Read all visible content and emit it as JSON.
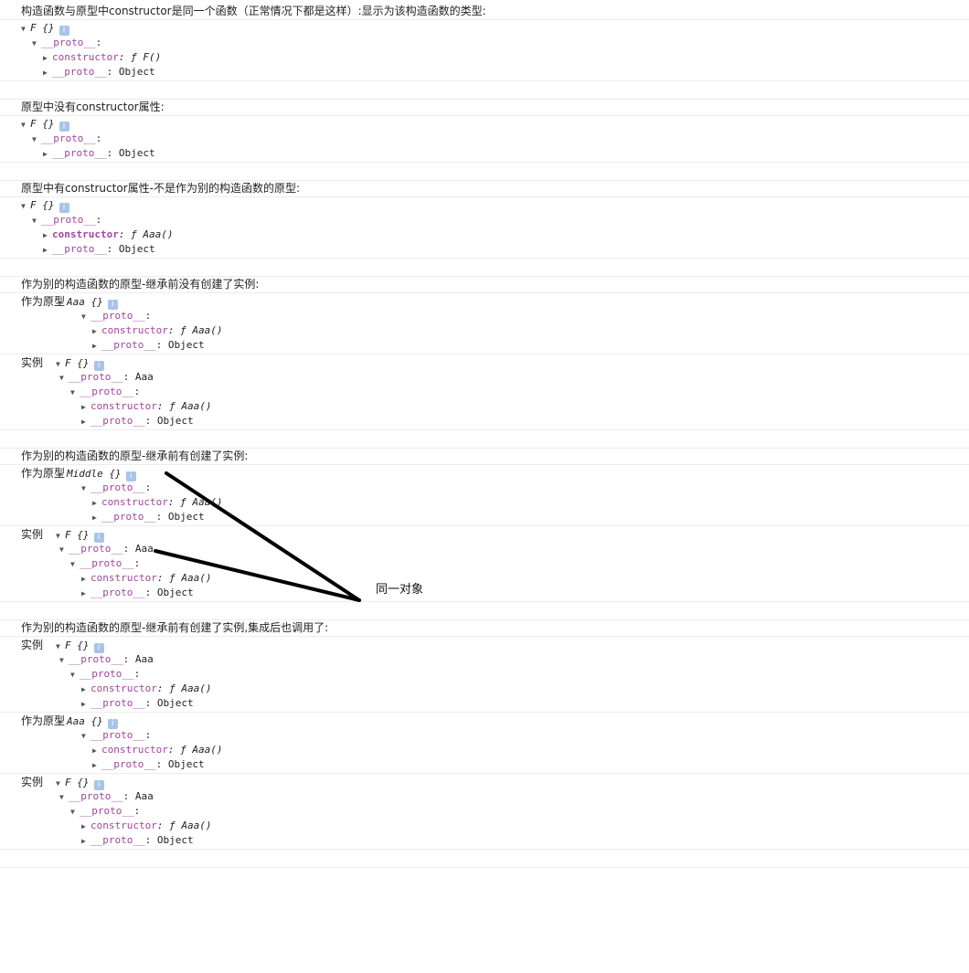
{
  "groups": [
    {
      "title": "构造函数与原型中constructor是同一个函数（正常情况下都是这样）:显示为该构造函数的类型:",
      "entries": [
        {
          "label": "",
          "lines": [
            {
              "d": 0,
              "t": "▼",
              "k": "F {}",
              "s": "obj",
              "info": true
            },
            {
              "d": 1,
              "t": "▼",
              "k": "__proto__",
              "v": ":"
            },
            {
              "d": 2,
              "t": "▶",
              "k": "constructor",
              "v": ": ƒ F()",
              "fn": true
            },
            {
              "d": 2,
              "t": "▶",
              "k": "__proto__",
              "v": ": Object"
            }
          ]
        }
      ]
    },
    {
      "title": "原型中没有constructor属性:",
      "entries": [
        {
          "label": "",
          "lines": [
            {
              "d": 0,
              "t": "▼",
              "k": "F {}",
              "s": "obj",
              "info": true
            },
            {
              "d": 1,
              "t": "▼",
              "k": "__proto__",
              "v": ":"
            },
            {
              "d": 2,
              "t": "▶",
              "k": "__proto__",
              "v": ": Object"
            }
          ]
        }
      ]
    },
    {
      "title": "原型中有constructor属性-不是作为别的构造函数的原型:",
      "entries": [
        {
          "label": "",
          "lines": [
            {
              "d": 0,
              "t": "▼",
              "k": "F {}",
              "s": "obj",
              "info": true
            },
            {
              "d": 1,
              "t": "▼",
              "k": "__proto__",
              "v": ":"
            },
            {
              "d": 2,
              "t": "▶",
              "k": "constructor",
              "v": ": ƒ Aaa()",
              "fn": true,
              "hl": true
            },
            {
              "d": 2,
              "t": "▶",
              "k": "__proto__",
              "v": ": Object"
            }
          ]
        }
      ]
    },
    {
      "title": "作为别的构造函数的原型-继承前没有创建了实例:",
      "entries": [
        {
          "label": "作为原型",
          "lines": [
            {
              "d": 0,
              "t": "▼",
              "k": "Aaa {}",
              "s": "obj",
              "info": true
            },
            {
              "d": 1,
              "t": "▼",
              "k": "__proto__",
              "v": ":"
            },
            {
              "d": 2,
              "t": "▶",
              "k": "constructor",
              "v": ": ƒ Aaa()",
              "fn": true
            },
            {
              "d": 2,
              "t": "▶",
              "k": "__proto__",
              "v": ": Object"
            }
          ]
        },
        {
          "label": "实例",
          "lines": [
            {
              "d": 0,
              "t": "▼",
              "k": "F {}",
              "s": "obj",
              "info": true
            },
            {
              "d": 1,
              "t": "▼",
              "k": "__proto__",
              "v": ": Aaa"
            },
            {
              "d": 2,
              "t": "▼",
              "k": "__proto__",
              "v": ":"
            },
            {
              "d": 3,
              "t": "▶",
              "k": "constructor",
              "v": ": ƒ Aaa()",
              "fn": true
            },
            {
              "d": 3,
              "t": "▶",
              "k": "__proto__",
              "v": ": Object"
            }
          ]
        }
      ]
    },
    {
      "title": "作为别的构造函数的原型-继承前有创建了实例:",
      "entries": [
        {
          "label": "作为原型",
          "lines": [
            {
              "d": 0,
              "t": "▼",
              "k": "Middle {}",
              "s": "obj",
              "info": true
            },
            {
              "d": 1,
              "t": "▼",
              "k": "__proto__",
              "v": ":"
            },
            {
              "d": 2,
              "t": "▶",
              "k": "constructor",
              "v": ": ƒ Aaa()",
              "fn": true
            },
            {
              "d": 2,
              "t": "▶",
              "k": "__proto__",
              "v": ": Object"
            }
          ]
        },
        {
          "label": "实例",
          "lines": [
            {
              "d": 0,
              "t": "▼",
              "k": "F {}",
              "s": "obj",
              "info": true
            },
            {
              "d": 1,
              "t": "▼",
              "k": "__proto__",
              "v": ": Aaa"
            },
            {
              "d": 2,
              "t": "▼",
              "k": "__proto__",
              "v": ":"
            },
            {
              "d": 3,
              "t": "▶",
              "k": "constructor",
              "v": ": ƒ Aaa()",
              "fn": true
            },
            {
              "d": 3,
              "t": "▶",
              "k": "__proto__",
              "v": ": Object"
            }
          ]
        }
      ]
    },
    {
      "title": "作为别的构造函数的原型-继承前有创建了实例,集成后也调用了:",
      "entries": [
        {
          "label": "实例",
          "lines": [
            {
              "d": 0,
              "t": "▼",
              "k": "F {}",
              "s": "obj",
              "info": true
            },
            {
              "d": 1,
              "t": "▼",
              "k": "__proto__",
              "v": ": Aaa"
            },
            {
              "d": 2,
              "t": "▼",
              "k": "__proto__",
              "v": ":"
            },
            {
              "d": 3,
              "t": "▶",
              "k": "constructor",
              "v": ": ƒ Aaa()",
              "fn": true
            },
            {
              "d": 3,
              "t": "▶",
              "k": "__proto__",
              "v": ": Object"
            }
          ]
        },
        {
          "label": "作为原型",
          "lines": [
            {
              "d": 0,
              "t": "▼",
              "k": "Aaa {}",
              "s": "obj",
              "info": true
            },
            {
              "d": 1,
              "t": "▼",
              "k": "__proto__",
              "v": ":"
            },
            {
              "d": 2,
              "t": "▶",
              "k": "constructor",
              "v": ": ƒ Aaa()",
              "fn": true
            },
            {
              "d": 2,
              "t": "▶",
              "k": "__proto__",
              "v": ": Object"
            }
          ]
        },
        {
          "label": "实例",
          "lines": [
            {
              "d": 0,
              "t": "▼",
              "k": "F {}",
              "s": "obj",
              "info": true
            },
            {
              "d": 1,
              "t": "▼",
              "k": "__proto__",
              "v": ": Aaa"
            },
            {
              "d": 2,
              "t": "▼",
              "k": "__proto__",
              "v": ":"
            },
            {
              "d": 3,
              "t": "▶",
              "k": "constructor",
              "v": ": ƒ Aaa()",
              "fn": true
            },
            {
              "d": 3,
              "t": "▶",
              "k": "__proto__",
              "v": ": Object"
            }
          ]
        }
      ]
    }
  ],
  "info_glyph": "i",
  "annotation": {
    "label": "同一对象",
    "color": "#000000"
  },
  "colors": {
    "key": "#a0479c",
    "info_badge": "#a8c4e8",
    "separator": "#ececec"
  }
}
